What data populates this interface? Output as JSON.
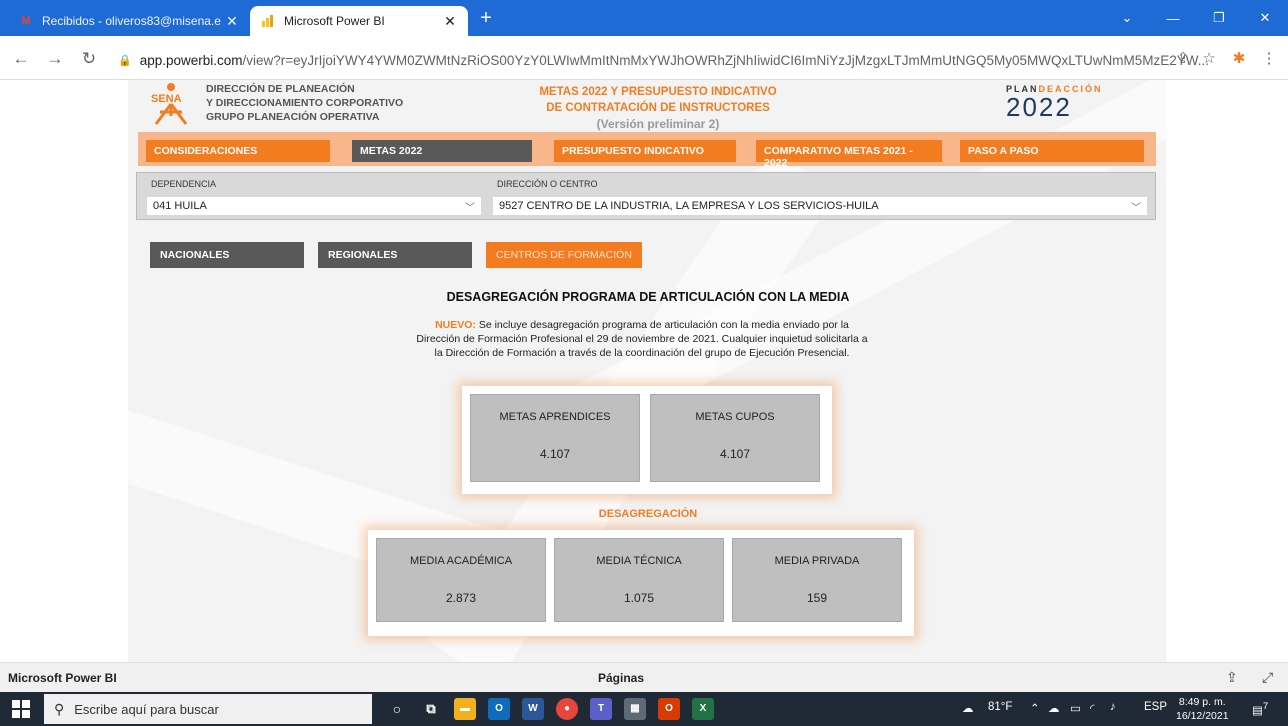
{
  "browser": {
    "tabs": [
      {
        "title": "Recibidos - oliveros83@misena.e",
        "favicon": "gmail-icon",
        "active": false
      },
      {
        "title": "Microsoft Power BI",
        "favicon": "powerbi-icon",
        "active": true
      }
    ],
    "url_host": "app.powerbi.com",
    "url_path": "/view?r=eyJrIjoiYWY4YWM0ZWMtNzRiOS00YzY0LWIwMmItNmMxYWJhOWRhZjNhIiwidCI6ImNiYzJjMzgxLTJmMmUtNGQ5My05MWQxLTUwNmM5MzE2YW..."
  },
  "header": {
    "org_lines": [
      "DIRECCIÓN DE PLANEACIÓN",
      "Y DIRECCIONAMIENTO CORPORATIVO",
      "GRUPO PLANEACIÓN OPERATIVA"
    ],
    "sena_logo_text": "SENA",
    "title_line1": "METAS 2022 Y PRESUPUESTO INDICATIVO",
    "title_line2": "DE CONTRATACIÓN DE INSTRUCTORES",
    "subtitle": "(Versión preliminar 2)",
    "plan_logo_pre": "PLAN",
    "plan_logo_mid": "DE",
    "plan_logo_post": "ACCIÓN",
    "plan_logo_year": "2022"
  },
  "menu": {
    "consideraciones": "CONSIDERACIONES",
    "metas": "METAS 2022",
    "presupuesto": "PRESUPUESTO INDICATIVO",
    "comparativo": "COMPARATIVO METAS 2021 - 2022",
    "paso": "PASO A PASO"
  },
  "filters": {
    "dependencia_label": "DEPENDENCIA",
    "dependencia_value": "041 HUILA",
    "centro_label": "DIRECCIÓN O CENTRO",
    "centro_value": "9527 CENTRO DE LA INDUSTRIA, LA EMPRESA Y LOS SERVICIOS-HUILA"
  },
  "segments": {
    "nacionales": "NACIONALES",
    "regionales": "REGIONALES",
    "centros": "CENTROS DE FORMACIÓN"
  },
  "section": {
    "title": "DESAGREGACIÓN PROGRAMA DE ARTICULACIÓN CON LA MEDIA",
    "note_prefix": "NUEVO:",
    "note_text": " Se incluye desagregación programa de articulación con la media enviado por la Dirección de Formación Profesional el 29 de noviembre de 2021. Cualquier inquietud solicitarla a la Dirección de Formación a través de la coordinación del grupo de Ejecución Presencial."
  },
  "metas_cards": [
    {
      "label": "METAS APRENDICES",
      "value": "4.107"
    },
    {
      "label": "METAS CUPOS",
      "value": "4.107"
    }
  ],
  "desagregacion_title": "DESAGREGACIÓN",
  "desag_cards": [
    {
      "label": "MEDIA ACADÉMICA",
      "value": "2.873"
    },
    {
      "label": "MEDIA TÉCNICA",
      "value": "1.075"
    },
    {
      "label": "MEDIA PRIVADA",
      "value": "159"
    }
  ],
  "pbi_footer": {
    "brand": "Microsoft Power BI",
    "pages": "Páginas"
  },
  "taskbar": {
    "search_placeholder": "Escribe aquí para buscar",
    "weather": "81°F",
    "lang": "ESP",
    "time": "8:49 p. m.",
    "date": "16/12/2021",
    "notif_count": "7"
  },
  "colors": {
    "accent_orange": "#f47c20",
    "menu_band": "#f8b68a",
    "grey_button": "#595959",
    "card_grey": "#bfbfbf",
    "chrome_blue": "#1f6bd6"
  }
}
